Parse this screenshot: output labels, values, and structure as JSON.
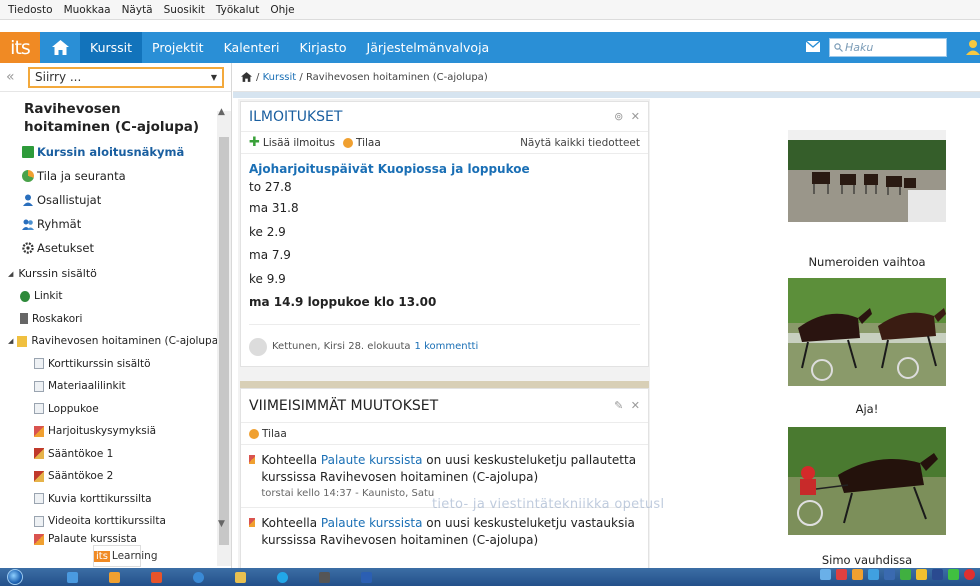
{
  "menubar": {
    "items": [
      "Tiedosto",
      "Muokkaa",
      "Näytä",
      "Suosikit",
      "Työkalut",
      "Ohje"
    ]
  },
  "topnav": {
    "logo": "its",
    "tabs": [
      "Kurssit",
      "Projektit",
      "Kalenteri",
      "Kirjasto",
      "Järjestelmänvalvoja"
    ],
    "active_tab": "Kurssit",
    "search_placeholder": "Haku"
  },
  "sidebar": {
    "goto_placeholder": "Siirry ...",
    "course_title": "Ravihevosen hoitaminen (C-ajolupa)",
    "items": [
      {
        "label": "Kurssin aloitusnäkymä",
        "icon": "monitor-icon",
        "color": "#2e9b3a"
      },
      {
        "label": "Tila ja seuranta",
        "icon": "pie-chart-icon",
        "color": "#4aa24a"
      },
      {
        "label": "Osallistujat",
        "icon": "user-icon",
        "color": "#2a6fbd"
      },
      {
        "label": "Ryhmät",
        "icon": "users-icon",
        "color": "#2a6fbd"
      },
      {
        "label": "Asetukset",
        "icon": "gear-icon",
        "color": "#333333"
      }
    ],
    "content_heading": "Kurssin sisältö",
    "content_items": [
      {
        "label": "Linkit",
        "icon": "globe-icon",
        "color": "#2e8a3a",
        "indent": 1
      },
      {
        "label": "Roskakori",
        "icon": "trash-icon",
        "color": "#555555",
        "indent": 1
      },
      {
        "label": "Ravihevosen hoitaminen (C-ajolupa)",
        "icon": "folder-icon",
        "color": "#f0c040",
        "indent": 1
      },
      {
        "label": "Korttikurssin sisältö",
        "icon": "page-icon",
        "color": "#9aa4b0",
        "indent": 2
      },
      {
        "label": "Materiaalilinkit",
        "icon": "page-icon",
        "color": "#9aa4b0",
        "indent": 2
      },
      {
        "label": "Loppukoe",
        "icon": "page-icon",
        "color": "#9aa4b0",
        "indent": 2
      },
      {
        "label": "Harjoituskysymyksiä",
        "icon": "discussion-icon",
        "color": "#d9534f",
        "indent": 2
      },
      {
        "label": "Sääntökoe 1",
        "icon": "test-icon",
        "color": "#c0392b",
        "indent": 2
      },
      {
        "label": "Sääntökoe 2",
        "icon": "test-icon",
        "color": "#c0392b",
        "indent": 2
      },
      {
        "label": "Kuvia korttikurssilta",
        "icon": "page-icon",
        "color": "#9aa4b0",
        "indent": 2
      },
      {
        "label": "Videoita korttikurssilta",
        "icon": "page-icon",
        "color": "#9aa4b0",
        "indent": 2
      },
      {
        "label": "Palaute kurssista",
        "icon": "discussion-icon",
        "color": "#d9534f",
        "indent": 2
      }
    ],
    "bottom_tab": {
      "logo": "its",
      "label": "Learning"
    }
  },
  "breadcrumb": {
    "items": [
      "Kurssit",
      "Ravihevosen hoitaminen (C-ajolupa)"
    ]
  },
  "announcements": {
    "title": "ILMOITUKSET",
    "add_label": "Lisää ilmoitus",
    "subscribe_label": "Tilaa",
    "show_all_label": "Näytä kaikki tiedotteet",
    "post_title": "Ajoharjoituspäivät Kuopiossa ja loppukoe",
    "lines": [
      "to 27.8",
      "ma 31.8",
      "ke 2.9",
      "ma 7.9",
      "ke 9.9"
    ],
    "final_line": "ma 14.9 loppukoe klo 13.00",
    "author": "Kettunen, Kirsi",
    "date": "28. elokuuta",
    "comments": "1 kommentti"
  },
  "changes": {
    "title": "VIIMEISIMMÄT MUUTOKSET",
    "subscribe_label": "Tilaa",
    "items": [
      {
        "prefix": "Kohteella",
        "link": "Palaute kurssista",
        "suffix": "on uusi keskusteluketju pallautetta kurssissa Ravihevosen hoitaminen (C-ajolupa)",
        "meta": "torstai kello 14:37 - Kaunisto, Satu"
      },
      {
        "prefix": "Kohteella",
        "link": "Palaute kurssista",
        "suffix": "on uusi keskusteluketju vastauksia kurssissa Ravihevosen hoitaminen (C-ajolupa)",
        "meta": ""
      }
    ]
  },
  "watermark": "tieto- ja viestintätekniikka opetuskäytössä OPH",
  "gallery": {
    "captions": [
      "Numeroiden vaihtoa",
      "Aja!",
      "Simo vauhdissa"
    ]
  },
  "colors": {
    "topbar": "#2a8fd6",
    "active_tab": "#1273bb",
    "logo": "#f08a24",
    "link": "#1a6fb5"
  }
}
